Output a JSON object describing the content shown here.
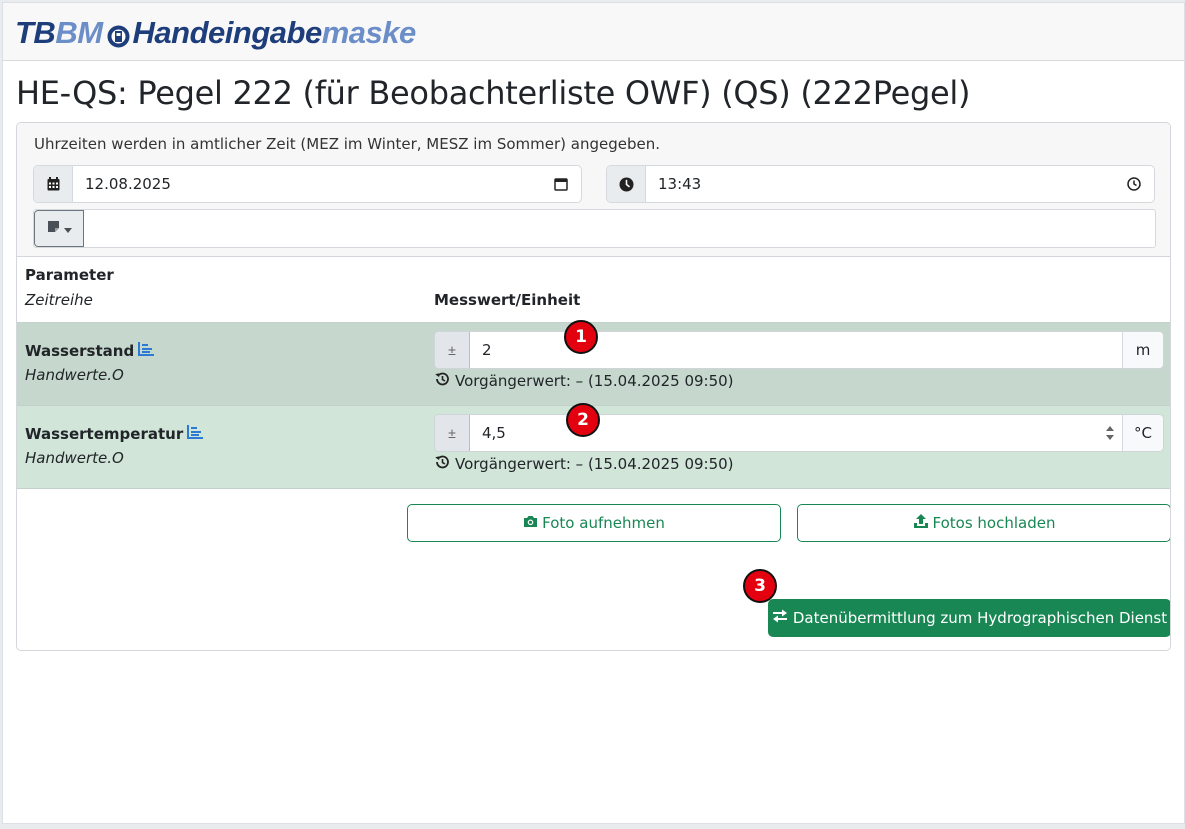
{
  "logo": {
    "part1": "TB",
    "part2": "BM",
    "part3": "Handeingabe",
    "part4": "maske"
  },
  "page": {
    "title": "HE-QS: Pegel 222 (für Beobachterliste OWF) (QS) (222Pegel)"
  },
  "header": {
    "notice": "Uhrzeiten werden in amtlicher Zeit (MEZ im Winter, MESZ im Sommer) angegeben.",
    "date_value": "12.08.2025",
    "time_value": "13:43",
    "date_icon": "calendar-icon",
    "time_icon": "clock-icon",
    "note_icon": "sticky-note-icon"
  },
  "table": {
    "col_parameter": "Parameter",
    "col_series": "Zeitreihe",
    "col_value": "Messwert/Einheit"
  },
  "rows": [
    {
      "name": "Wasserstand",
      "series": "Handwerte.O",
      "value": "2",
      "unit": "m",
      "sign": "±",
      "previous": "Vorgängerwert: – (15.04.2025 09:50)"
    },
    {
      "name": "Wassertemperatur",
      "series": "Handwerte.O",
      "value": "4,5",
      "unit": "°C",
      "sign": "±",
      "previous": "Vorgängerwert: – (15.04.2025 09:50)"
    }
  ],
  "actions": {
    "photo_take": "Foto aufnehmen",
    "photo_upload": "Fotos hochladen",
    "submit": "Datenübermittlung zum Hydrographischen Dienst"
  },
  "markers": [
    "1",
    "2",
    "3"
  ],
  "colors": {
    "accent_green": "#198754",
    "row1_bg": "#c6d8cd",
    "row2_bg": "#d1e5d9",
    "marker_red": "#e3000f",
    "logo_dark": "#1d3d7b",
    "logo_light": "#6b8dc8"
  }
}
